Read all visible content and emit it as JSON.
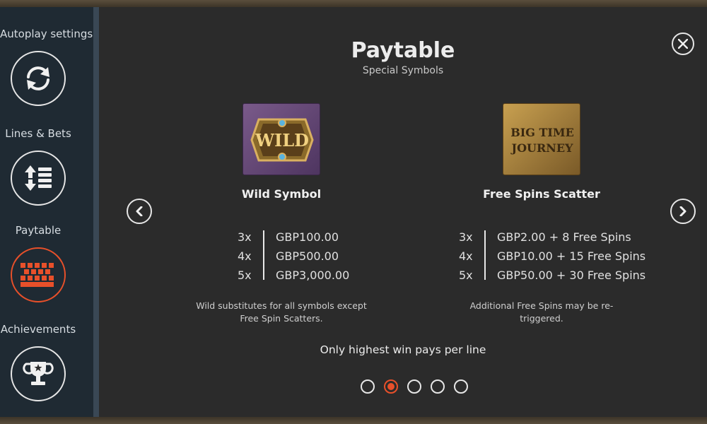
{
  "sidebar": {
    "items": [
      {
        "label": "Autoplay settings",
        "icon": "autoplay-refresh-icon"
      },
      {
        "label": "Lines & Bets",
        "icon": "lines-bets-icon"
      },
      {
        "label": "Paytable",
        "icon": "paytable-grid-icon",
        "active": true
      },
      {
        "label": "Achievements",
        "icon": "trophy-icon"
      }
    ]
  },
  "main": {
    "title": "Paytable",
    "subtitle": "Special Symbols",
    "footer_note": "Only highest win pays per line",
    "pagination": {
      "pages": 5,
      "current": 2
    }
  },
  "symbols": [
    {
      "name": "Wild Symbol",
      "image_text": "WILD",
      "payouts": [
        {
          "mult": "3x",
          "value": "GBP100.00"
        },
        {
          "mult": "4x",
          "value": "GBP500.00"
        },
        {
          "mult": "5x",
          "value": "GBP3,000.00"
        }
      ],
      "desc_line1": "Wild substitutes for all symbols except",
      "desc_line2": "Free Spin Scatters."
    },
    {
      "name": "Free Spins Scatter",
      "image_text_1": "BIG TIME",
      "image_text_2": "JOURNEY",
      "payouts": [
        {
          "mult": "3x",
          "value": "GBP2.00 + 8 Free Spins"
        },
        {
          "mult": "4x",
          "value": "GBP10.00 + 15 Free Spins"
        },
        {
          "mult": "5x",
          "value": "GBP50.00 + 30 Free Spins"
        }
      ],
      "desc_line1": "Additional Free Spins may be re-",
      "desc_line2": "triggered."
    }
  ],
  "colors": {
    "accent": "#e8502a",
    "panel": "#2b2b2b",
    "sidebar": "#1f2a33"
  }
}
